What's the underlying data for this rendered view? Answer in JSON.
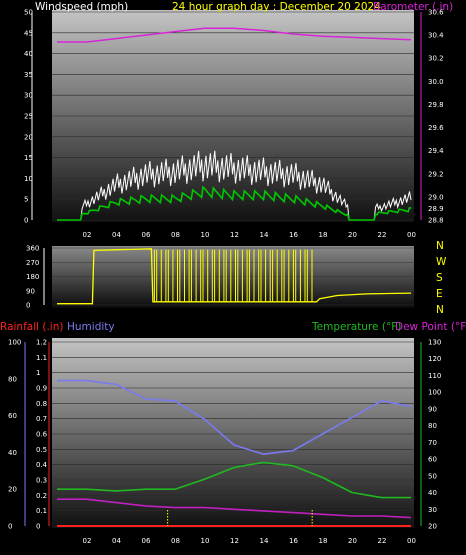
{
  "header": {
    "windspeed_label": "Windspeed (mph)",
    "title": "24 hour graph day : December 20 2024",
    "barometer_label": "Barometer (.in)"
  },
  "compass": [
    "N",
    "W",
    "S",
    "E",
    "N"
  ],
  "bottom_labels": {
    "rainfall": "Rainfall (.in)",
    "humidity": "Humidity",
    "temperature": "Temperature (°F)",
    "dewpoint": "Dew Point (°F)"
  },
  "x_ticks": [
    "02",
    "04",
    "06",
    "08",
    "10",
    "12",
    "14",
    "16",
    "18",
    "20",
    "22",
    "00"
  ],
  "colors": {
    "title": "#ffff00",
    "barometer": "#d824d8",
    "wind_gust": "#ffffff",
    "wind_avg": "#00c800",
    "direction": "#ffff00",
    "humidity": "#7a7af0",
    "temperature": "#20b820",
    "dewpoint": "#c020c0",
    "rain": "#ff2020"
  },
  "chart_data": [
    {
      "type": "line",
      "title": "Windspeed (mph) / Barometer (.in)",
      "x_hours": [
        0,
        2,
        4,
        6,
        8,
        10,
        12,
        14,
        16,
        18,
        20,
        22,
        24
      ],
      "xlabels": [
        "02",
        "04",
        "06",
        "08",
        "10",
        "12",
        "14",
        "16",
        "18",
        "20",
        "22",
        "00"
      ],
      "ylabel": "Windspeed (mph)",
      "ylim": [
        0,
        50
      ],
      "yticks": [
        0,
        5,
        10,
        15,
        20,
        25,
        30,
        35,
        40,
        45,
        50
      ],
      "y2label": "Barometer (.in)",
      "y2lim": [
        28.8,
        30.6
      ],
      "y2ticks": [
        28.8,
        28.9,
        29.0,
        29.2,
        29.4,
        29.6,
        29.8,
        30.0,
        30.2,
        30.4,
        30.6
      ],
      "series": [
        {
          "name": "Wind gust",
          "axis": "y",
          "color": "#ffffff",
          "values": [
            0,
            5,
            11,
            14,
            15,
            17,
            16,
            15,
            14,
            11,
            3,
            4,
            7
          ]
        },
        {
          "name": "Wind average",
          "axis": "y",
          "color": "#00c800",
          "values": [
            0,
            2,
            5,
            6,
            6,
            8,
            7,
            7,
            6,
            4,
            1,
            2,
            3
          ]
        },
        {
          "name": "Barometer",
          "axis": "y2",
          "color": "#d824d8",
          "values": [
            30.34,
            30.34,
            30.37,
            30.4,
            30.43,
            30.46,
            30.46,
            30.44,
            30.41,
            30.39,
            30.38,
            30.37,
            30.36
          ]
        }
      ]
    },
    {
      "type": "line",
      "title": "Wind direction",
      "ylim": [
        0,
        360
      ],
      "yticks": [
        0,
        90,
        180,
        270,
        360
      ],
      "series": [
        {
          "name": "Direction",
          "color": "#ffff00",
          "x_hours": [
            0,
            2.4,
            2.5,
            6.4,
            6.5,
            17.6,
            17.8,
            19.0,
            21.0,
            24
          ],
          "values": [
            8,
            8,
            345,
            355,
            20,
            20,
            40,
            60,
            70,
            75
          ]
        }
      ]
    },
    {
      "type": "line",
      "title": "Rainfall / Humidity / Temperature / Dew Point",
      "x_hours": [
        0,
        2,
        4,
        6,
        8,
        10,
        12,
        14,
        16,
        18,
        20,
        22,
        24
      ],
      "xlabels": [
        "02",
        "04",
        "06",
        "08",
        "10",
        "12",
        "14",
        "16",
        "18",
        "20",
        "22",
        "00"
      ],
      "y_rain_lim": [
        0,
        1.2
      ],
      "y_rain_ticks": [
        0,
        0.1,
        0.2,
        0.3,
        0.4,
        0.5,
        0.6,
        0.7,
        0.8,
        0.9,
        1,
        1.1,
        1.2
      ],
      "y_hum_lim": [
        0,
        100
      ],
      "y_hum_ticks": [
        0,
        20,
        40,
        60,
        80,
        100
      ],
      "y_temp_lim": [
        20,
        130
      ],
      "y_temp_ticks": [
        20,
        30,
        40,
        50,
        60,
        70,
        80,
        90,
        100,
        110,
        120,
        130
      ],
      "series": [
        {
          "name": "Humidity",
          "axis": "humidity",
          "color": "#7a7af0",
          "values": [
            79,
            79,
            77,
            69,
            68,
            58,
            44,
            39,
            41,
            50,
            59,
            68,
            65
          ]
        },
        {
          "name": "Temperature (°F)",
          "axis": "temperature",
          "color": "#20b820",
          "values": [
            42,
            42,
            41,
            42,
            42,
            48,
            55,
            58,
            56,
            49,
            40,
            37,
            37
          ]
        },
        {
          "name": "Dew Point (°F)",
          "axis": "temperature",
          "color": "#c020c0",
          "values": [
            36,
            36,
            34,
            32,
            31,
            31,
            30,
            29,
            28,
            27,
            26,
            26,
            25
          ]
        },
        {
          "name": "Rainfall (.in)",
          "axis": "rain",
          "color": "#ff2020",
          "values": [
            0,
            0,
            0,
            0,
            0,
            0,
            0,
            0,
            0,
            0,
            0,
            0,
            0
          ]
        }
      ]
    }
  ]
}
